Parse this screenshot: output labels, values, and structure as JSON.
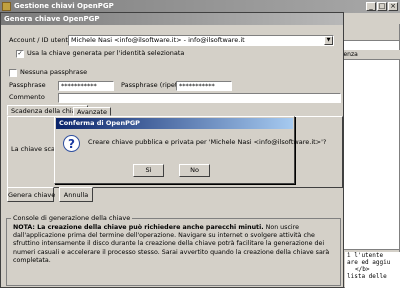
{
  "bg_window": {
    "title": "Gestione chiavi OpenPGP",
    "right_header": "adenza",
    "code_lines": [
      "ì l'utente",
      "are ed aggiu",
      "</b>",
      "lista delle"
    ]
  },
  "dialog": {
    "title": "Genera chiave OpenPGP",
    "account_label": "Account / ID utente",
    "account_value": "Michele Nasi <info@ilsoftware.it> - info@ilsoftware.it",
    "use_key_label": "Usa la chiave generata per l'identità selezionata",
    "use_key_checked": true,
    "no_passphrase_label": "Nessuna passphrase",
    "no_passphrase_checked": false,
    "passphrase_label": "Passphrase",
    "passphrase_value": "***********",
    "passphrase_repeat_label": "Passphrase (ripeti)",
    "passphrase_repeat_value": "***********",
    "comment_label": "Commento",
    "comment_value": "",
    "tabs": [
      "Scadenza della chiave",
      "Avanzate"
    ],
    "expiry_partial_label": "La chiave scad",
    "generate_button": "Genera chiave",
    "cancel_button": "Annulla",
    "console_title": "Console di generazione della chiave",
    "console_bold": "NOTA: La creazione della chiave può richiedere anche parecchi minuti.",
    "console_text": " Non uscire dall'applicazione prima del termine dell'operazione. Navigare su internet o svolgere attività che sfruttino intensamente il disco durante la creazione della chiave potrà facilitare la generazione dei numeri casuali e accelerare il processo stesso. Sarai avvertito quando la creazione della chiave sarà completata."
  },
  "confirm": {
    "title": "Conferma di OpenPGP",
    "message": "Creare chiave pubblica e privata per 'Michele Nasi <info@ilsoftware.it>'?",
    "yes_button": "Sì",
    "no_button": "No"
  }
}
